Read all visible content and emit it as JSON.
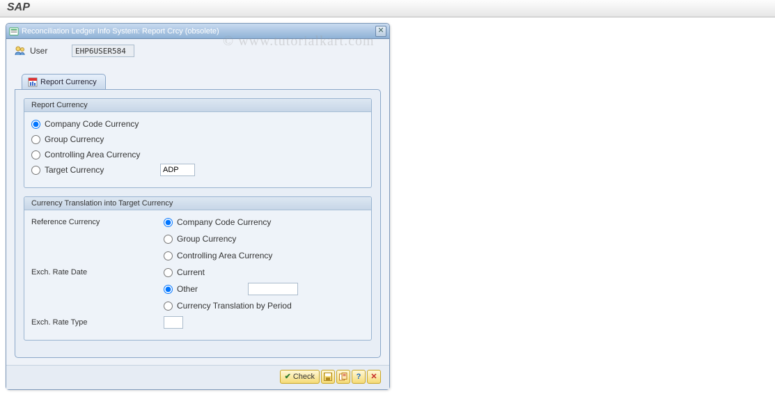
{
  "watermark": "© www.tutorialkart.com",
  "saplabel": "SAP",
  "dialog": {
    "title": "Reconciliation Ledger Info System: Report Crcy (obsolete)",
    "close_tooltip": "Close"
  },
  "user": {
    "label": "User",
    "value": "EHP6USER584"
  },
  "tab": {
    "label": "Report Currency"
  },
  "group1": {
    "title": "Report Currency",
    "options": {
      "company_code": "Company Code Currency",
      "group": "Group Currency",
      "controlling_area": "Controlling Area Currency",
      "target": "Target Currency"
    },
    "target_value": "ADP",
    "selected": "company_code"
  },
  "group2": {
    "title": "Currency Translation into Target Currency",
    "labels": {
      "reference_currency": "Reference Currency",
      "rate_date": "Exch. Rate Date",
      "rate_type": "Exch. Rate Type"
    },
    "ref_options": {
      "company_code": "Company Code Currency",
      "group": "Group Currency",
      "controlling_area": "Controlling Area Currency"
    },
    "ref_selected": "company_code",
    "date_options": {
      "current": "Current",
      "other": "Other",
      "by_period": "Currency Translation by Period"
    },
    "date_selected": "other",
    "other_date_value": "",
    "rate_type_value": ""
  },
  "buttons": {
    "check": "Check"
  }
}
